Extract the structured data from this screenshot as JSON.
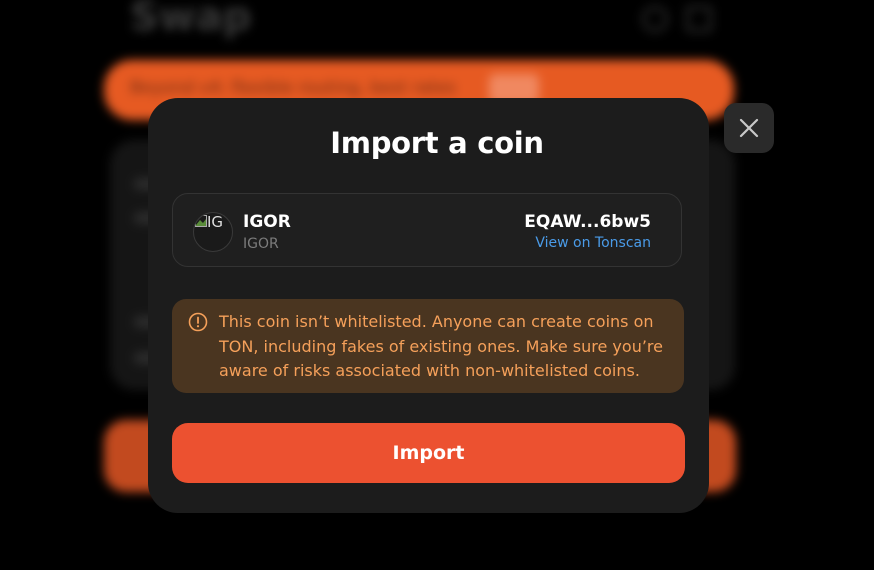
{
  "background": {
    "page_title": "Swap",
    "banner_text": "Beyond v4: flexible routing, best rates"
  },
  "modal": {
    "title": "Import a coin",
    "coin": {
      "avatar_alt": "IG",
      "name": "IGOR",
      "symbol": "IGOR",
      "address": "EQAW...6bw5",
      "explorer_link": "View on Tonscan"
    },
    "warning": {
      "icon": "alert-circle-icon",
      "text": "This coin isn’t whitelisted. Anyone can create coins on TON, including fakes of existing ones. Make sure you’re aware of risks associated with non-whitelisted coins."
    },
    "import_button": "Import",
    "close_icon": "close-icon"
  },
  "colors": {
    "modal_bg": "#1c1c1c",
    "accent": "#ec5130",
    "link": "#4a9be8",
    "warning_bg": "#4a3520",
    "warning_text": "#f5a05a"
  }
}
